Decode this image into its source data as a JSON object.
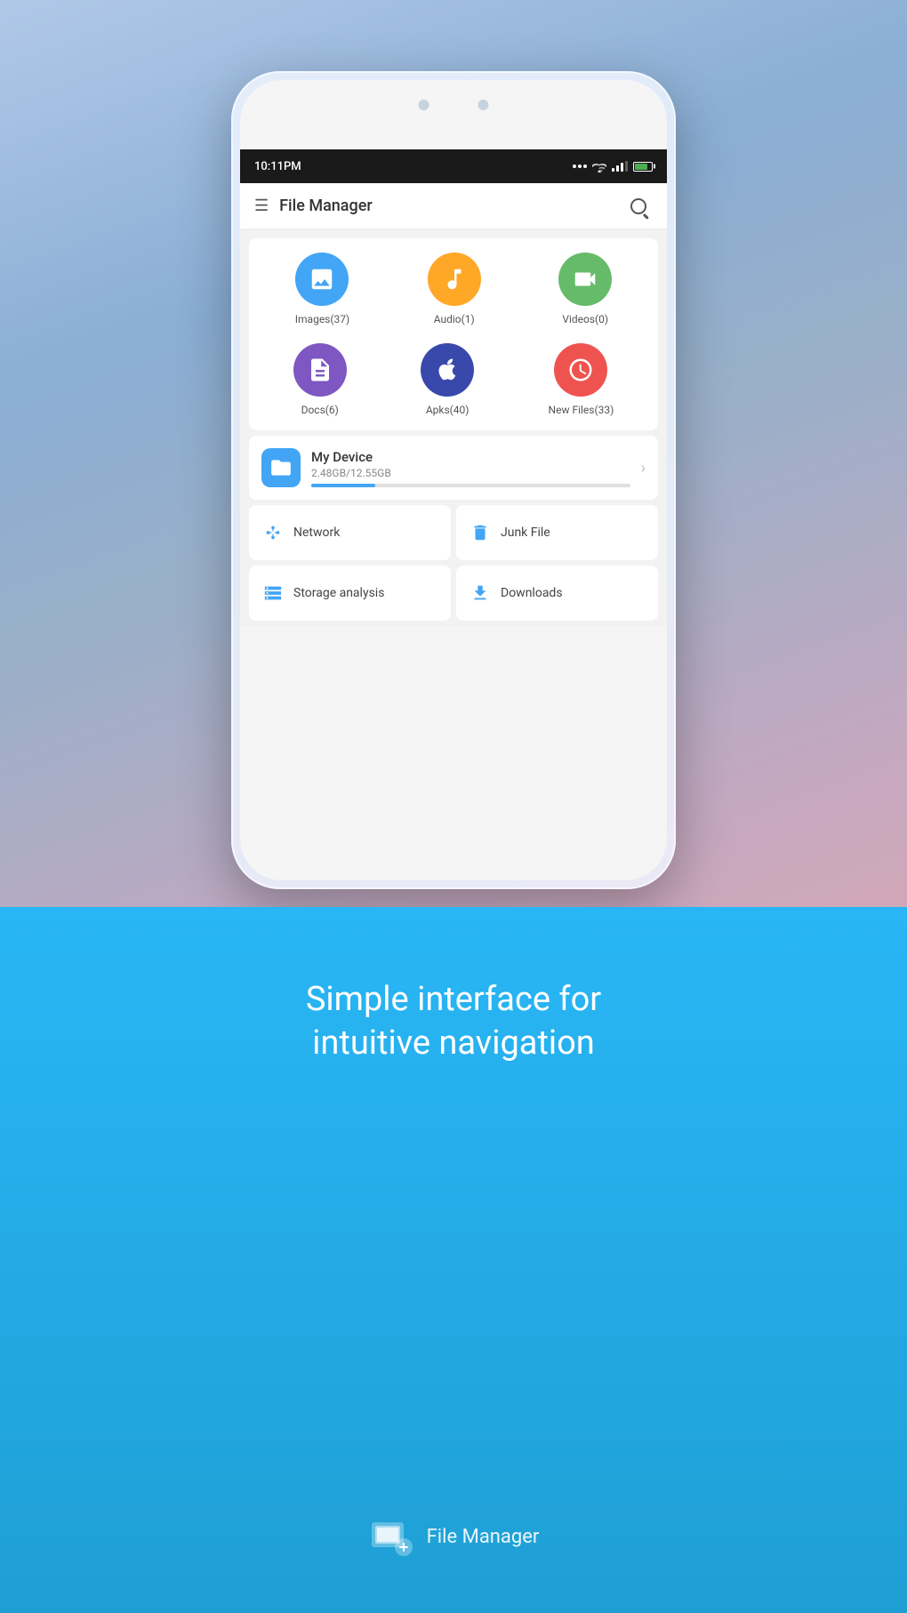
{
  "background": {
    "gradient": "purple-blue sky"
  },
  "status_bar": {
    "time": "10:11PM",
    "dots": [
      "···"
    ],
    "battery_percent": 80
  },
  "app_header": {
    "title": "File Manager",
    "menu_icon": "☰",
    "search_label": "search"
  },
  "categories": {
    "row1": [
      {
        "label": "Images(37)",
        "color": "#42a5f5",
        "icon": "images"
      },
      {
        "label": "Audio(1)",
        "color": "#ffa726",
        "icon": "audio"
      },
      {
        "label": "Videos(0)",
        "color": "#66bb6a",
        "icon": "videos"
      }
    ],
    "row2": [
      {
        "label": "Docs(6)",
        "color": "#7e57c2",
        "icon": "docs"
      },
      {
        "label": "Apks(40)",
        "color": "#3949ab",
        "icon": "apks"
      },
      {
        "label": "New Files(33)",
        "color": "#ef5350",
        "icon": "newfiles"
      }
    ]
  },
  "device": {
    "name": "My Device",
    "storage_used": "2.48GB",
    "storage_total": "12.55GB",
    "storage_label": "2.48GB/12.55GB",
    "progress_percent": 20
  },
  "quick_actions": [
    {
      "label": "Network",
      "icon": "network"
    },
    {
      "label": "Junk File",
      "icon": "junk"
    },
    {
      "label": "Storage analysis",
      "icon": "storage"
    },
    {
      "label": "Downloads",
      "icon": "downloads"
    }
  ],
  "tagline": {
    "line1": "Simple interface for",
    "line2": "intuitive navigation"
  },
  "footer": {
    "app_name": "File Manager"
  }
}
